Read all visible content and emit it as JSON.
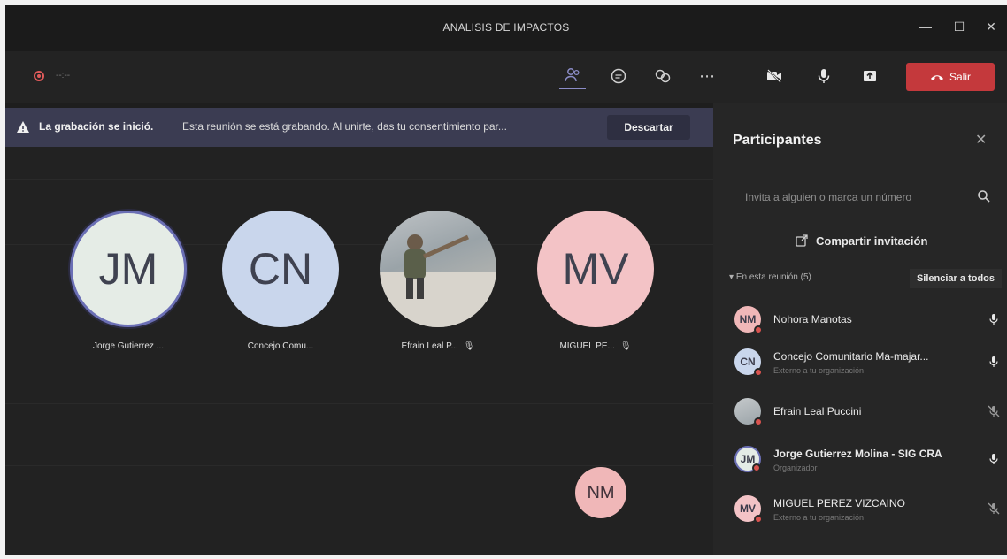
{
  "window": {
    "title": "ANALISIS DE IMPACTOS"
  },
  "toolbar": {
    "timer": "--:--",
    "leave_label": "Salir"
  },
  "banner": {
    "title": "La grabación se inició.",
    "message": "Esta reunión se está grabando. Al unirte, das tu consentimiento par...",
    "dismiss_label": "Descartar"
  },
  "stage": {
    "tiles": [
      {
        "initials": "JM",
        "name": "Jorge Gutierrez ...",
        "color": "#e5ece6",
        "muted": false
      },
      {
        "initials": "CN",
        "name": "Concejo Comu...",
        "color": "#c9d6ec",
        "muted": false
      },
      {
        "initials": "",
        "name": "Efrain Leal P...",
        "color": "#b8bec3",
        "muted": true
      },
      {
        "initials": "MV",
        "name": "MIGUEL PE...",
        "color": "#f3c3c6",
        "muted": true
      }
    ],
    "speaker_initials": "NM"
  },
  "panel": {
    "title": "Participantes",
    "invite_placeholder": "Invita a alguien o marca un número",
    "share_label": "Compartir invitación",
    "section_label": "En esta reunión (5)",
    "mute_all_label": "Silenciar a todos",
    "participants": [
      {
        "initials": "NM",
        "name": "Nohora Manotas",
        "subtitle": "",
        "color": "#f0b7b8"
      },
      {
        "initials": "CN",
        "name": "Concejo Comunitario Ma-majar...",
        "subtitle": "Externo a tu organización",
        "color": "#c9d6ec"
      },
      {
        "initials": "",
        "name": "Efrain Leal Puccini",
        "subtitle": "",
        "color": "#b8bec3"
      },
      {
        "initials": "JM",
        "name": "Jorge Gutierrez Molina - SIG CRA",
        "subtitle": "Organizador",
        "color": "#e5ece6"
      },
      {
        "initials": "MV",
        "name": "MIGUEL PEREZ VIZCAINO",
        "subtitle": "Externo a tu organización",
        "color": "#f3c3c6"
      }
    ]
  },
  "colors": {
    "accent": "#8b8cc7",
    "leave": "#c4393c",
    "banner": "#3b3c52"
  }
}
